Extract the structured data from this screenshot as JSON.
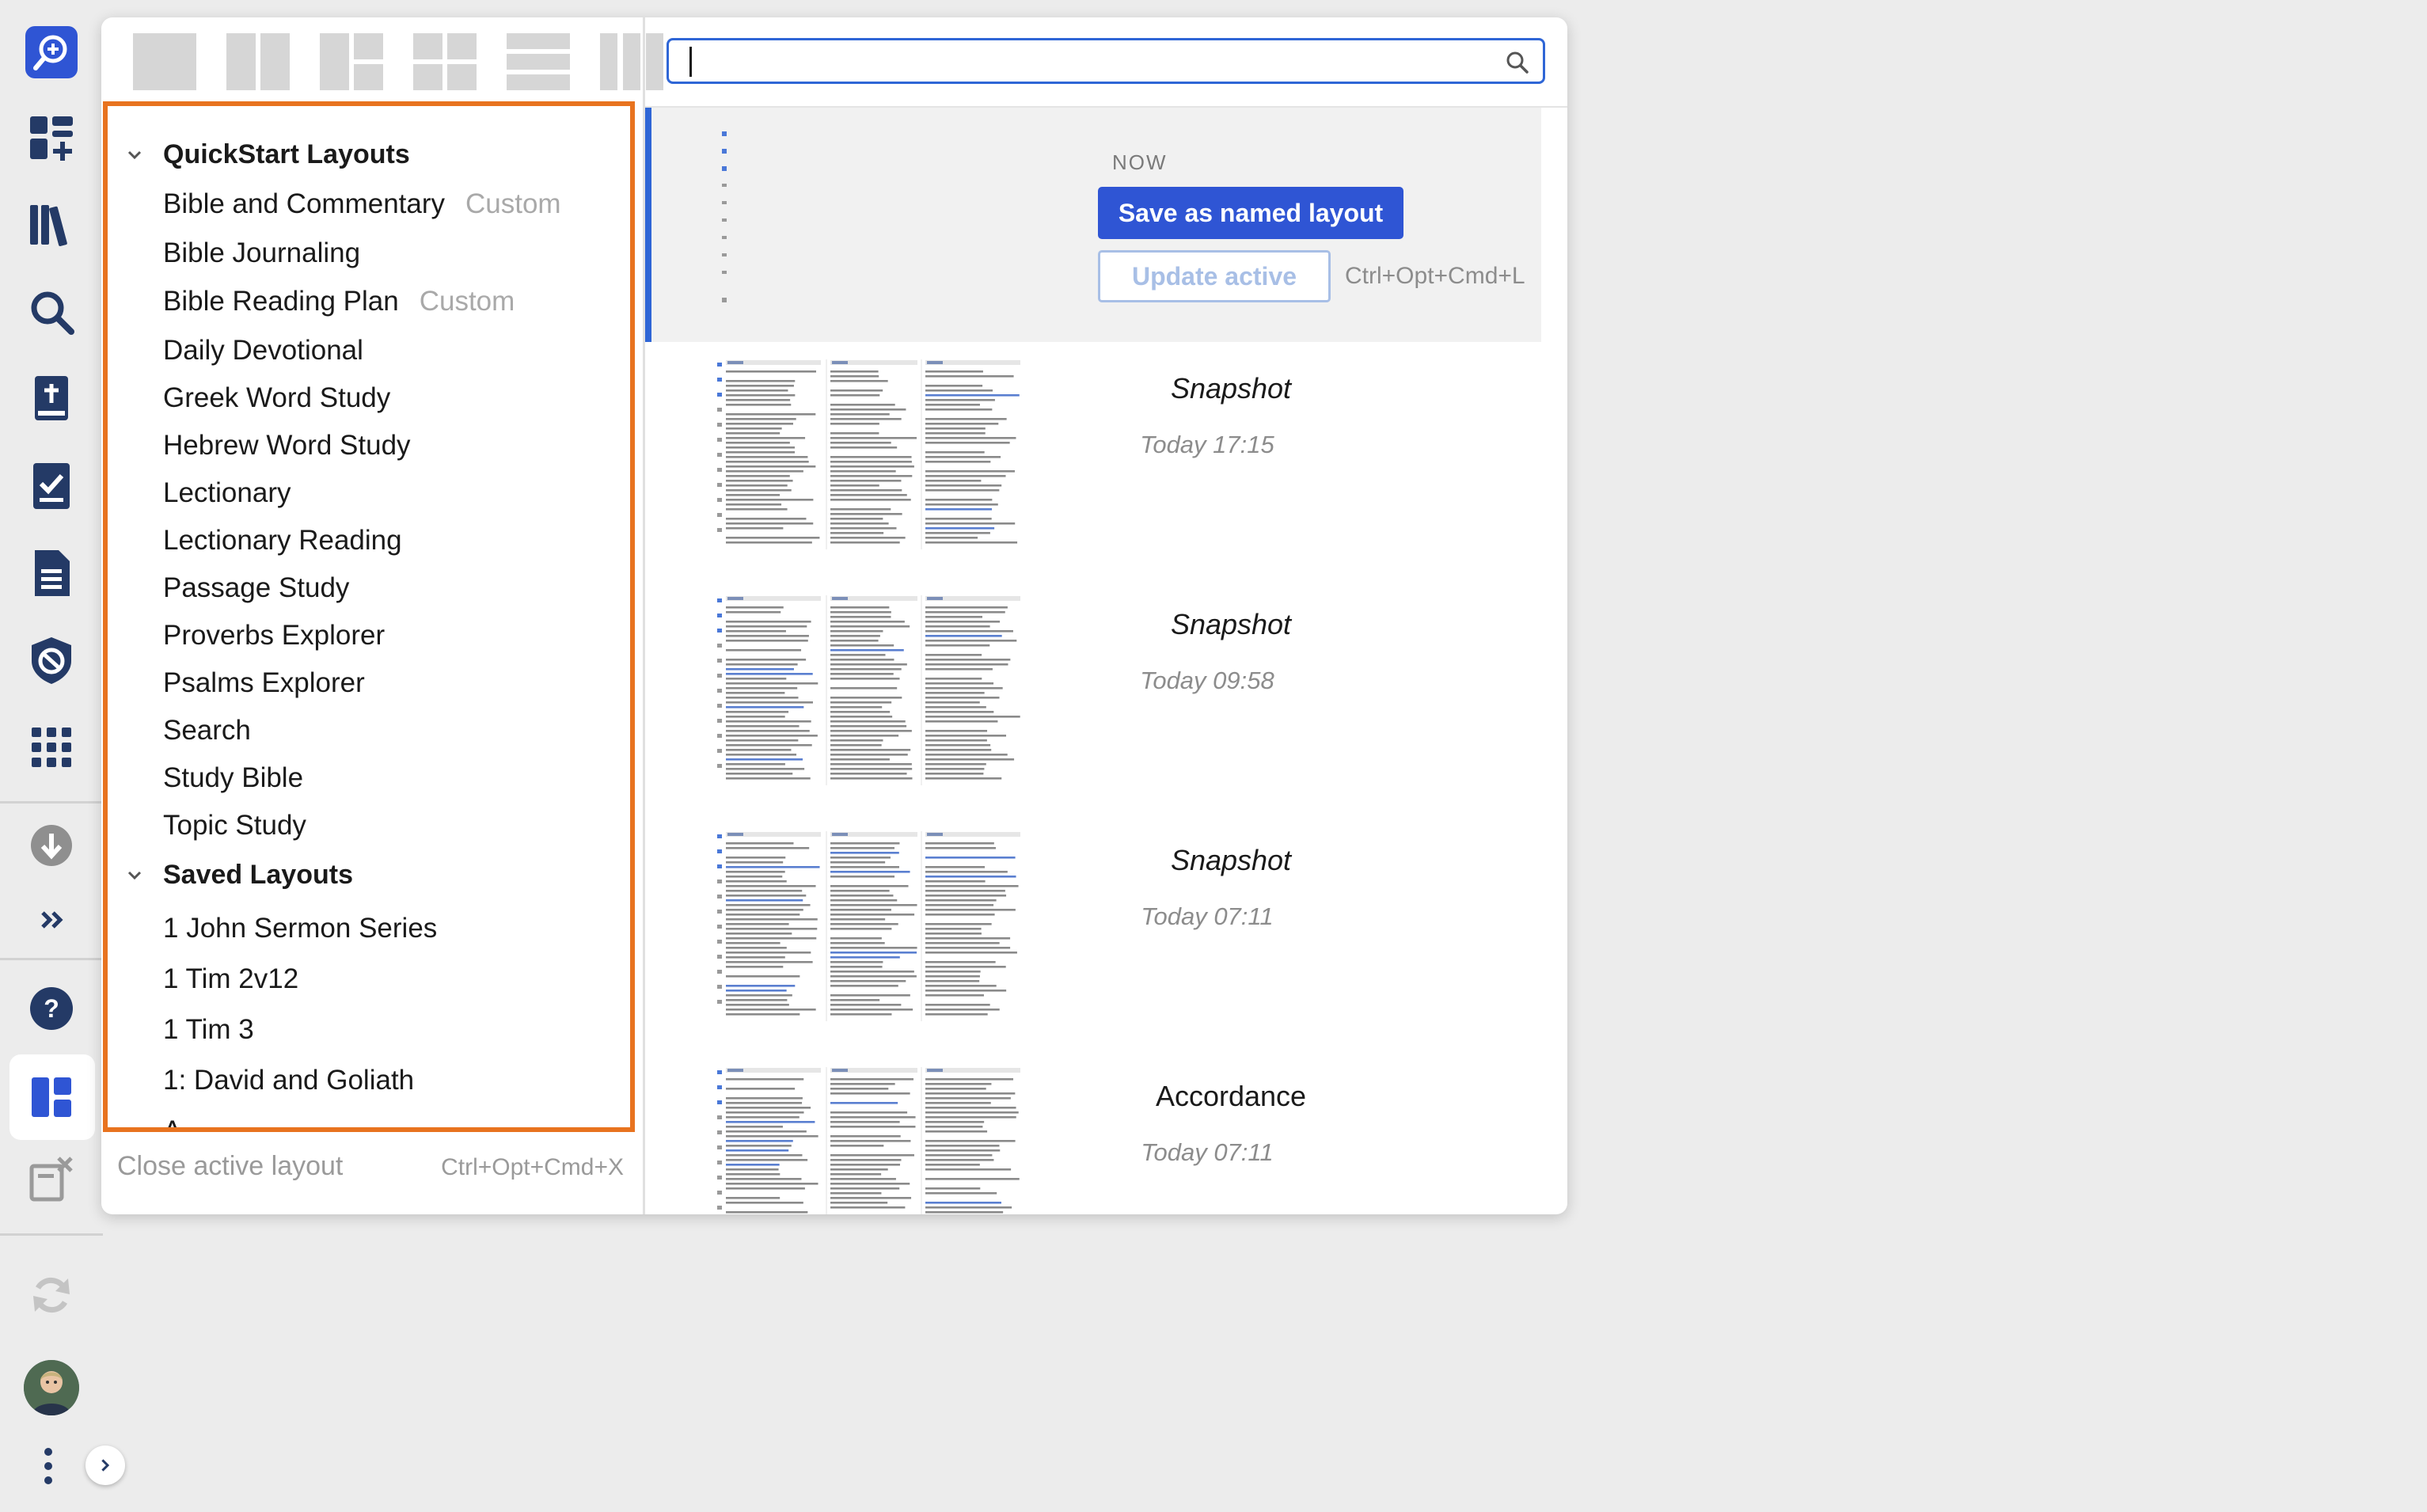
{
  "rail": {
    "icons": [
      "add-search-icon",
      "add-panel-icon",
      "library-icon",
      "search-icon",
      "bible-add-icon",
      "checklist-icon",
      "document-icon",
      "shield-check-icon",
      "apps-grid-icon",
      "download-icon",
      "expand-icon",
      "help-icon",
      "layouts-icon",
      "close-panels-icon",
      "sync-icon",
      "avatar",
      "more-icon",
      "chevron-right-icon"
    ]
  },
  "layouts_list": {
    "groups": [
      {
        "title": "QuickStart Layouts",
        "items": [
          {
            "label": "Bible and Commentary",
            "tag": "Custom"
          },
          {
            "label": "Bible Journaling",
            "tag": ""
          },
          {
            "label": "Bible Reading Plan",
            "tag": "Custom"
          },
          {
            "label": "Daily Devotional",
            "tag": ""
          },
          {
            "label": "Greek Word Study",
            "tag": ""
          },
          {
            "label": "Hebrew Word Study",
            "tag": ""
          },
          {
            "label": "Lectionary",
            "tag": ""
          },
          {
            "label": "Lectionary Reading",
            "tag": ""
          },
          {
            "label": "Passage Study",
            "tag": ""
          },
          {
            "label": "Proverbs Explorer",
            "tag": ""
          },
          {
            "label": "Psalms Explorer",
            "tag": ""
          },
          {
            "label": "Search",
            "tag": ""
          },
          {
            "label": "Study Bible",
            "tag": ""
          },
          {
            "label": "Topic Study",
            "tag": ""
          }
        ]
      },
      {
        "title": "Saved Layouts",
        "items": [
          {
            "label": "1 John Sermon Series",
            "tag": ""
          },
          {
            "label": "1 Tim 2v12",
            "tag": ""
          },
          {
            "label": "1 Tim 3",
            "tag": ""
          },
          {
            "label": "1: David and Goliath",
            "tag": ""
          },
          {
            "label": "A",
            "tag": ""
          }
        ]
      }
    ],
    "close_active": "Close active layout",
    "close_shortcut": "Ctrl+Opt+Cmd+X"
  },
  "search": {
    "value": "",
    "placeholder": ""
  },
  "now": {
    "label": "NOW",
    "save_button": "Save as named layout",
    "update_button": "Update active",
    "update_shortcut": "Ctrl+Opt+Cmd+L"
  },
  "snapshots": [
    {
      "title": "Snapshot",
      "time": "Today 17:15"
    },
    {
      "title": "Snapshot",
      "time": "Today 09:58"
    },
    {
      "title": "Snapshot",
      "time": "Today 07:11"
    },
    {
      "title": "Accordance",
      "time": "Today 07:11"
    }
  ],
  "colors": {
    "accent": "#2f55d4",
    "highlight_border": "#e8731f",
    "rail_icon": "#243a66"
  }
}
